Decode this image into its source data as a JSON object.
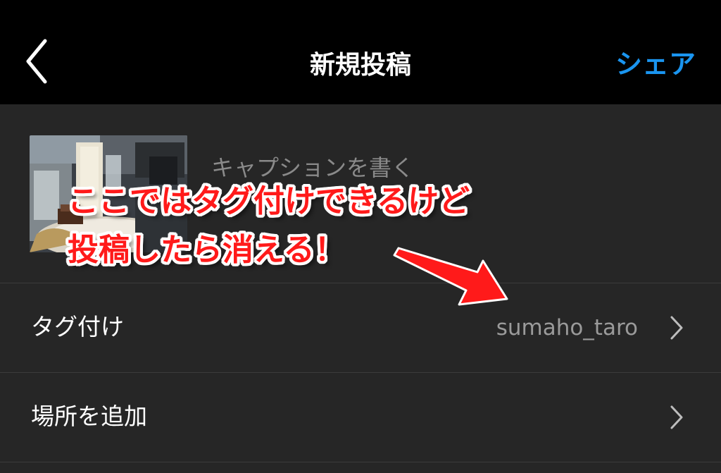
{
  "header": {
    "title": "新規投稿",
    "share_label": "シェア",
    "back_icon": "chevron-left-icon"
  },
  "compose": {
    "caption_placeholder": "キャプションを書く"
  },
  "rows": [
    {
      "label": "タグ付け",
      "value": "sumaho_taro",
      "icon": "chevron-right-icon"
    },
    {
      "label": "場所を追加",
      "value": "",
      "icon": "chevron-right-icon"
    }
  ],
  "annotation": {
    "line1": "ここではタグ付けできるけど",
    "line2": "投稿したら消える！"
  },
  "colors": {
    "accent": "#1a95f0",
    "background": "#262626",
    "header_bg": "#000000",
    "annotation_text": "#ff1a1a",
    "arrow": "#ff1a1a"
  }
}
